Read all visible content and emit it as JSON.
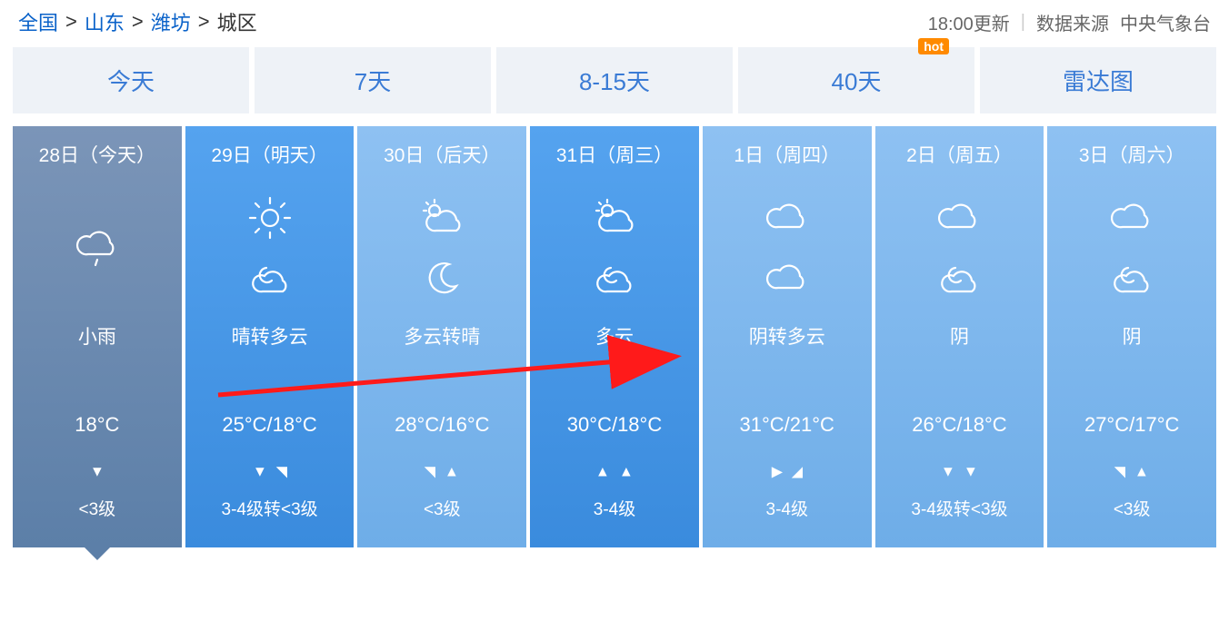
{
  "breadcrumb": {
    "items": [
      "全国",
      "山东",
      "潍坊",
      "城区"
    ]
  },
  "meta": {
    "update": "18:00更新",
    "source_label": "数据来源",
    "source": "中央气象台"
  },
  "tabs": [
    {
      "label": "今天",
      "badge": false
    },
    {
      "label": "7天",
      "badge": false
    },
    {
      "label": "8-15天",
      "badge": false
    },
    {
      "label": "40天",
      "badge": true
    },
    {
      "label": "雷达图",
      "badge": false
    }
  ],
  "days": [
    {
      "date": "28日（今天）",
      "day_icon": "rain",
      "night_icon": "",
      "condition": "小雨",
      "temp": "18°C",
      "wind_dir": [
        "S"
      ],
      "wind": "<3级",
      "style": "active"
    },
    {
      "date": "29日（明天）",
      "day_icon": "sun",
      "night_icon": "night-cloud",
      "condition": "晴转多云",
      "temp": "25°C/18°C",
      "wind_dir": [
        "S",
        "NE"
      ],
      "wind": "3-4级转<3级",
      "style": "normal"
    },
    {
      "date": "30日（后天）",
      "day_icon": "day-cloud",
      "night_icon": "moon",
      "condition": "多云转晴",
      "temp": "28°C/16°C",
      "wind_dir": [
        "NE",
        "N"
      ],
      "wind": "<3级",
      "style": "light"
    },
    {
      "date": "31日（周三）",
      "day_icon": "day-cloud",
      "night_icon": "night-cloud",
      "condition": "多云",
      "temp": "30°C/18°C",
      "wind_dir": [
        "N",
        "N"
      ],
      "wind": "3-4级",
      "style": "normal"
    },
    {
      "date": "1日（周四）",
      "day_icon": "cloud",
      "night_icon": "cloud",
      "condition": "阴转多云",
      "temp": "31°C/21°C",
      "wind_dir": [
        "E",
        "SE"
      ],
      "wind": "3-4级",
      "style": "light"
    },
    {
      "date": "2日（周五）",
      "day_icon": "cloud",
      "night_icon": "night-cloud",
      "condition": "阴",
      "temp": "26°C/18°C",
      "wind_dir": [
        "S",
        "S"
      ],
      "wind": "3-4级转<3级",
      "style": "light"
    },
    {
      "date": "3日（周六）",
      "day_icon": "cloud",
      "night_icon": "night-cloud",
      "condition": "阴",
      "temp": "27°C/17°C",
      "wind_dir": [
        "NE",
        "N"
      ],
      "wind": "<3级",
      "style": "light"
    }
  ]
}
